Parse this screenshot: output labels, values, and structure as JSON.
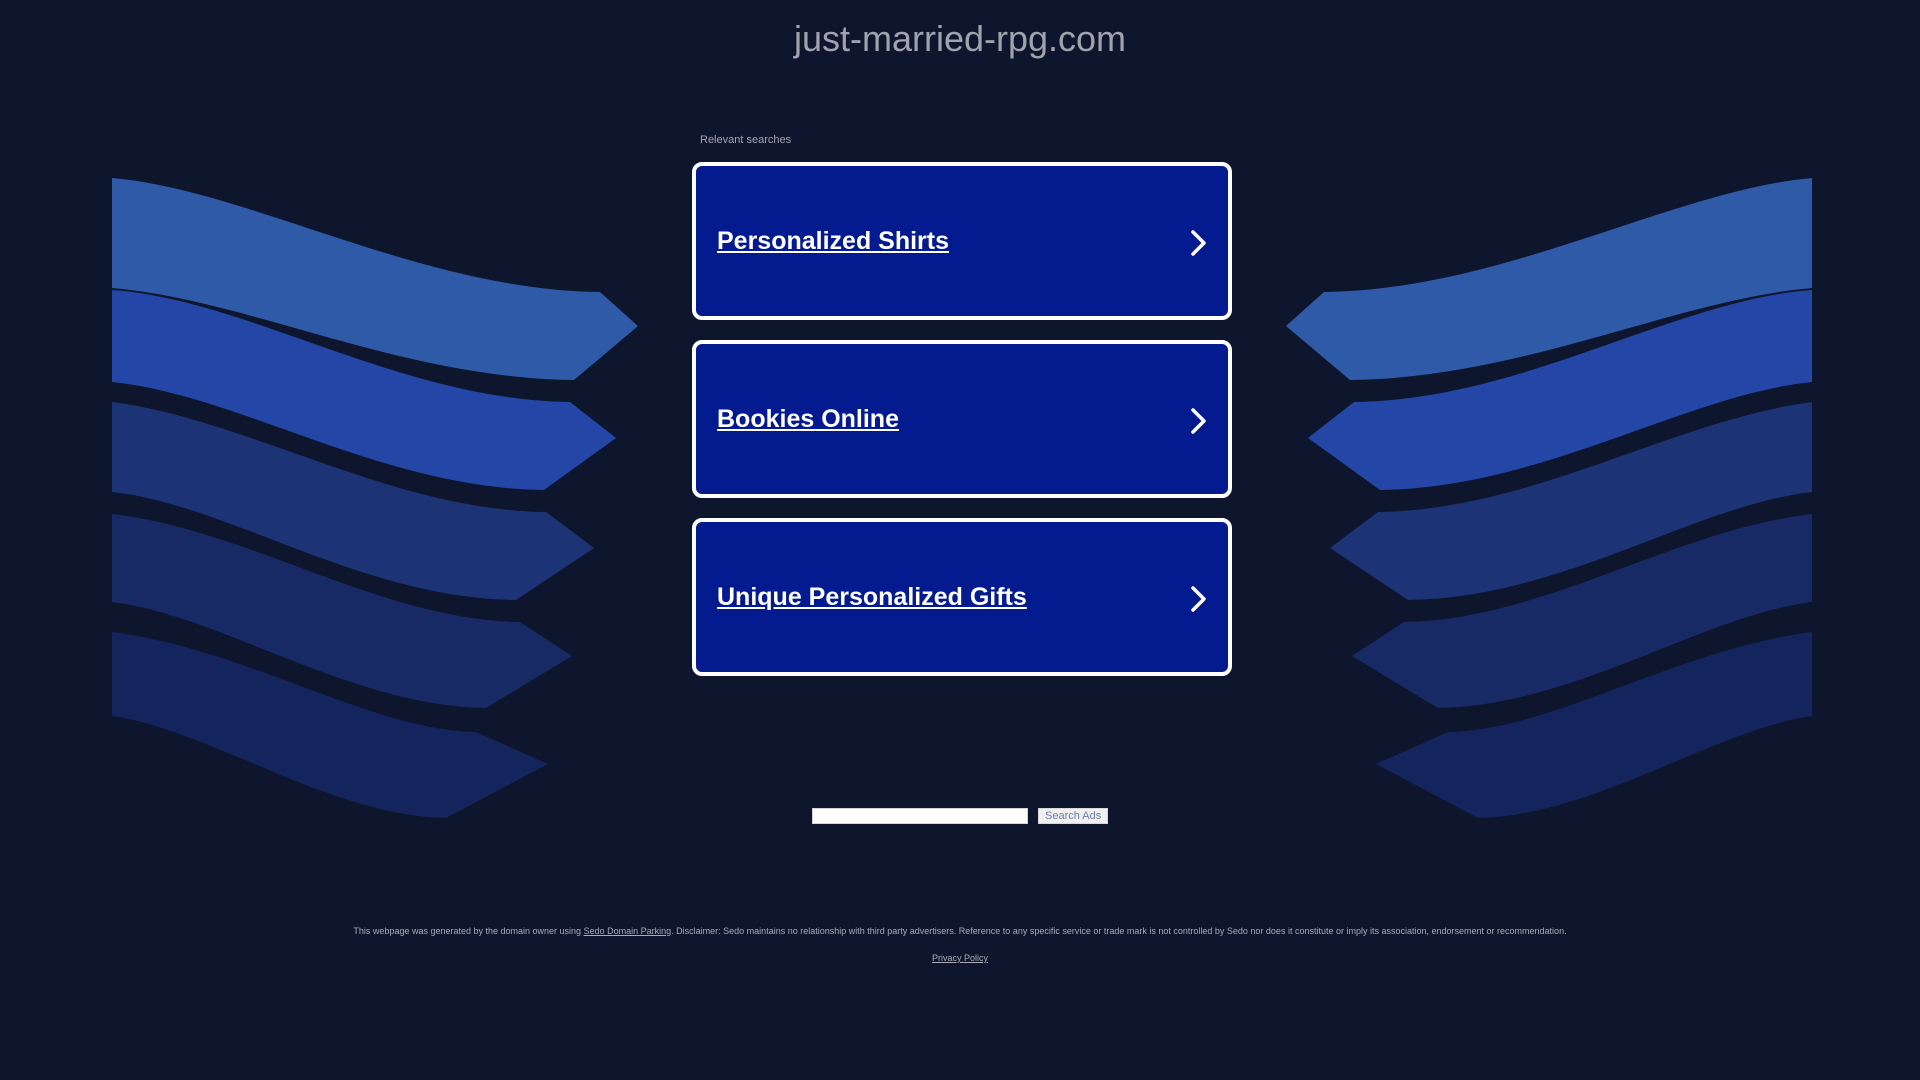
{
  "header": {
    "domain": "just-married-rpg.com"
  },
  "results": {
    "label": "Relevant searches",
    "items": [
      {
        "label": "Personalized Shirts"
      },
      {
        "label": "Bookies Online"
      },
      {
        "label": "Unique Personalized Gifts"
      }
    ]
  },
  "search": {
    "value": "",
    "button_label": "Search Ads"
  },
  "footer": {
    "disclaimer_prefix": "This webpage was generated by the domain owner using",
    "disclaimer_link": "Sedo Domain Parking",
    "disclaimer_suffix": ". Disclaimer: Sedo maintains no relationship with third party advertisers. Reference to any specific service or trade mark is not controlled by Sedo nor does it constitute or imply its association, endorsement or recommendation.",
    "privacy_label": "Privacy Policy"
  },
  "colors": {
    "background": "#0e162d",
    "card": "#041a8f",
    "wave_1": "#2f5aa8",
    "wave_2": "#2446a6",
    "wave_3": "#1c3475",
    "wave_4": "#172a66",
    "wave_5": "#14245c"
  }
}
